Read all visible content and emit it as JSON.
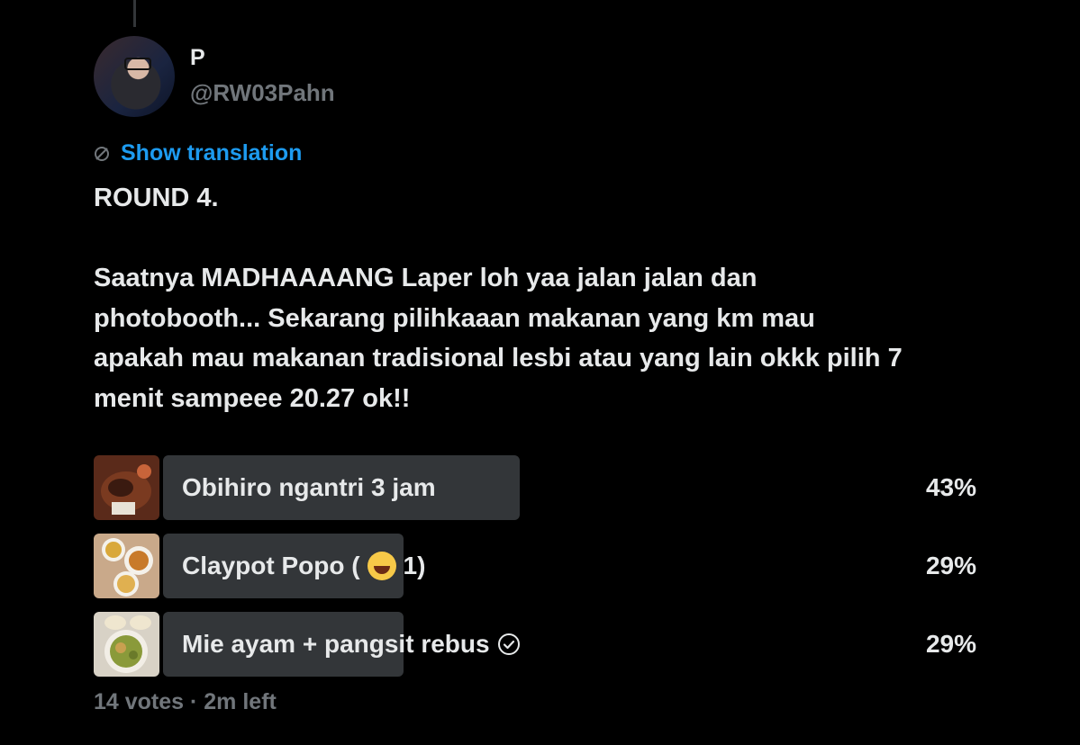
{
  "author": {
    "name": "P",
    "handle": "@RW03Pahn"
  },
  "translation": {
    "icon": "translate-icon",
    "label": "Show translation"
  },
  "tweet": {
    "lines": [
      "ROUND 4.",
      "",
      "Saatnya MADHAAAANG Laper loh yaa jalan jalan dan",
      "photobooth... Sekarang pilihkaaan makanan yang km mau",
      "apakah mau makanan tradisional lesbi atau yang lain okkk pilih 7",
      "menit sampeee 20.27 ok!!"
    ]
  },
  "poll": {
    "options": [
      {
        "label": "Obihiro ngantri 3 jam",
        "percent": "43%",
        "fill_fraction": 0.43,
        "selected": false
      },
      {
        "label": "Claypot Popo (",
        "suffix": " 1)",
        "emoji": "face-with-tears-of-joy",
        "percent": "29%",
        "fill_fraction": 0.29,
        "selected": false
      },
      {
        "label": "Mie ayam + pangsit rebus",
        "percent": "29%",
        "fill_fraction": 0.29,
        "selected": true,
        "selected_icon": "check-circle-icon"
      }
    ],
    "meta": "14 votes · 2m left"
  },
  "colors": {
    "background": "#000000",
    "text": "#e7e9ea",
    "muted": "#71767b",
    "link": "#1d9bf0",
    "bar": "#333639"
  }
}
